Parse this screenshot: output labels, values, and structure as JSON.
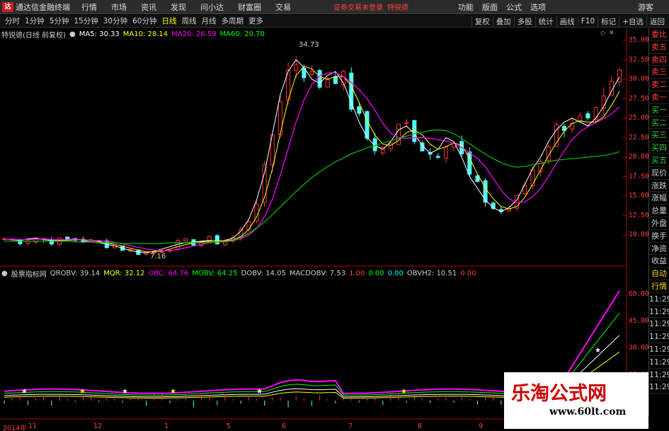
{
  "menubar": {
    "app_title": "通达信金融终端",
    "menus": [
      "行情",
      "市场",
      "资讯",
      "发现",
      "问小达",
      "财富圈",
      "交易"
    ],
    "notice": "证券交易未登录",
    "stock_name": "特锐德",
    "right_menus": [
      "功能",
      "版面",
      "公式",
      "选项"
    ],
    "guest": "游客",
    "logo_icon": "tdx-logo-icon"
  },
  "toolbar": {
    "periods": [
      "分时",
      "1分钟",
      "5分钟",
      "15分钟",
      "30分钟",
      "60分钟",
      "日线",
      "周线",
      "月线",
      "多周期",
      "更多"
    ],
    "active_period": "日线",
    "right_buttons": [
      "复权",
      "叠加",
      "多股",
      "统计",
      "画线",
      "F10",
      "标记",
      "+自选",
      "返回"
    ]
  },
  "main_info": {
    "stock_label": "特锐德(日线 前复权)",
    "ma5": "MA5: 30.33",
    "ma10": "MA10: 28.14",
    "ma20": "MA20: 26.59",
    "ma60": "MA60: 20.70",
    "ma5_color": "#ffffff",
    "ma10_color": "#ffff00",
    "ma20_color": "#ff00ff",
    "ma60_color": "#00ff00",
    "high_label": "34.73",
    "low_label": "7.16"
  },
  "indicator_info": {
    "name": "股票指标网",
    "qrobv": "QROBV: 39.14",
    "mqr": "MQR: 32.12",
    "obc": "OBC: 64.76",
    "mobv": "MOBV: 64.25",
    "dobv": "DOBV: 14.05",
    "macdobv": "MACDOBV: 7.53",
    "v1": "1.00",
    "v2": "0.00",
    "v3": "0.00",
    "obvh2": "OBVH2: 10.51",
    "v4": "0.00"
  },
  "right_panel": {
    "items": [
      "委比",
      "卖五",
      "卖四",
      "卖三",
      "卖二",
      "卖一",
      "买一",
      "买二",
      "买三",
      "买四",
      "买五",
      "现价",
      "涨跌",
      "涨幅",
      "总量",
      "外盘",
      "换手",
      "净资",
      "收益",
      "自动",
      "行情",
      "11:29",
      "11:29",
      "11:29",
      "11:29",
      "11:29",
      "11:29",
      "11:29",
      "11:29"
    ]
  },
  "price_axis": [
    "35.00",
    "32.50",
    "30.00",
    "27.50",
    "25.00",
    "22.50",
    "20.00",
    "17.50",
    "15.00",
    "12.50",
    "10.00"
  ],
  "ind_axis": [
    "60.00",
    "45.00",
    "30.00",
    "15.00"
  ],
  "x_axis": [
    {
      "label": "2014年",
      "pos": 4
    },
    {
      "label": "11",
      "pos": 40
    },
    {
      "label": "12",
      "pos": 132
    },
    {
      "label": "1",
      "pos": 232
    },
    {
      "label": "5",
      "pos": 320
    },
    {
      "label": "6",
      "pos": 398
    },
    {
      "label": "7",
      "pos": 492
    },
    {
      "label": "8",
      "pos": 590
    },
    {
      "label": "9",
      "pos": 676
    }
  ],
  "watermark": {
    "title": "乐淘公式网",
    "url": "www.60lt.com"
  },
  "chart_data": {
    "type": "candlestick",
    "ylim": [
      7.0,
      36.0
    ],
    "ma5": [
      9.5,
      9.4,
      9.3,
      9.5,
      9.6,
      9.4,
      9.3,
      9.2,
      9.4,
      9.5,
      9.3,
      9.1,
      9.0,
      8.8,
      8.6,
      8.3,
      8.0,
      7.8,
      7.7,
      7.9,
      8.2,
      8.5,
      8.8,
      9.0,
      9.1,
      9.2,
      9.3,
      9.2,
      9.3,
      9.6,
      10.5,
      12.0,
      14.5,
      18.0,
      23.0,
      28.0,
      31.0,
      32.5,
      31.5,
      30.0,
      29.5,
      30.5,
      31.0,
      29.5,
      27.0,
      24.5,
      22.5,
      21.5,
      21.0,
      22.0,
      23.5,
      24.0,
      23.0,
      21.5,
      20.5,
      21.0,
      22.5,
      22.0,
      20.0,
      17.5,
      16.0,
      14.5,
      13.5,
      13.0,
      13.5,
      14.5,
      16.5,
      18.5,
      20.0,
      22.0,
      23.5,
      24.5,
      25.0,
      24.5,
      24.0,
      25.0,
      26.5,
      28.5,
      30.3
    ],
    "ma60": [
      9.2,
      9.2,
      9.2,
      9.2,
      9.2,
      9.2,
      9.2,
      9.2,
      9.2,
      9.1,
      9.1,
      9.1,
      9.0,
      9.0,
      9.0,
      8.9,
      8.9,
      8.9,
      8.9,
      8.9,
      8.9,
      9.0,
      9.0,
      9.0,
      9.0,
      9.0,
      9.0,
      9.1,
      9.1,
      9.3,
      9.7,
      10.2,
      10.9,
      11.7,
      12.6,
      13.6,
      14.6,
      15.6,
      16.5,
      17.4,
      18.1,
      18.8,
      19.4,
      19.9,
      20.4,
      20.8,
      21.2,
      21.5,
      21.8,
      22.1,
      22.4,
      22.7,
      23.0,
      23.2,
      23.4,
      23.5,
      23.4,
      23.0,
      22.4,
      21.7,
      21.0,
      20.4,
      19.8,
      19.3,
      18.9,
      18.7,
      18.8,
      19.0,
      19.2,
      19.4,
      19.6,
      19.7,
      19.8,
      19.9,
      20.0,
      20.1,
      20.2,
      20.4,
      20.7
    ]
  }
}
